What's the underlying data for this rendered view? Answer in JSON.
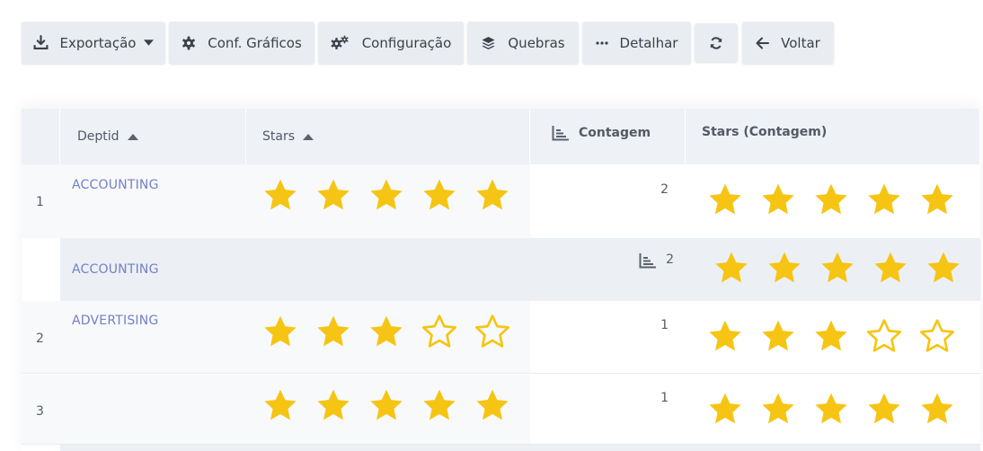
{
  "toolbar": {
    "export_label": "Exportação",
    "chart_config_label": "Conf. Gráficos",
    "config_label": "Configuração",
    "breaks_label": "Quebras",
    "detail_label": "Detalhar",
    "back_label": "Voltar"
  },
  "grid": {
    "columns": {
      "deptid": "Deptid",
      "stars": "Stars",
      "count": "Contagem",
      "stars_count": "Stars (Contagem)"
    },
    "rows": [
      {
        "index": "1",
        "deptid": "ACCOUNTING",
        "stars": 5,
        "count": "2",
        "stars_count": 5
      },
      {
        "index": "",
        "deptid": "ACCOUNTING",
        "subtotal": true,
        "count": "2",
        "stars_count": 5
      },
      {
        "index": "2",
        "deptid": "ADVERTISING",
        "stars": 3,
        "count": "1",
        "stars_count": 3
      },
      {
        "index": "3",
        "deptid": "",
        "stars": 5,
        "count": "1",
        "stars_count": 5
      }
    ],
    "max_stars": 5
  },
  "colors": {
    "star": "#f6c513",
    "link": "#7480c4",
    "header_bg": "#eef1f6",
    "button_bg": "#e9edf2"
  },
  "icons": {
    "export": "download-icon",
    "chart_config": "gear-icon",
    "config": "gears-icon",
    "breaks": "layers-icon",
    "detail": "ellipsis-icon",
    "refresh": "refresh-icon",
    "back": "arrow-left-icon",
    "count_header": "chart-icon"
  }
}
